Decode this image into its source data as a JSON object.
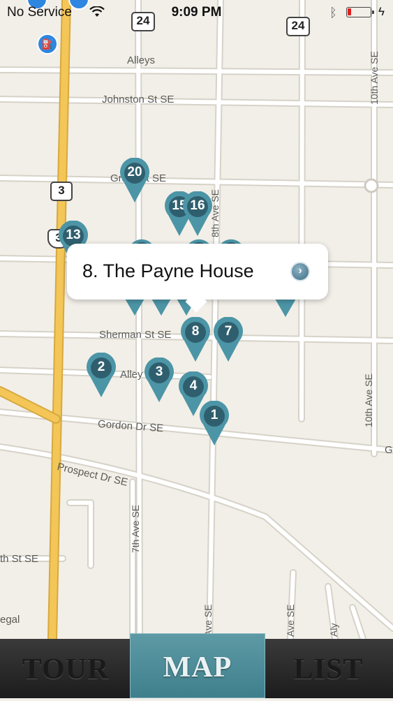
{
  "status_bar": {
    "carrier": "No Service",
    "time": "9:09 PM"
  },
  "map": {
    "street_labels": {
      "alleys_top": "Alleys",
      "johnston": "Johnston St SE",
      "grant": "Grant St SE",
      "sherman": "Sherman St SE",
      "alley_mid": "Alley",
      "gordon": "Gordon Dr SE",
      "prospect": "Prospect Dr SE",
      "street_left": "th St SE",
      "tenth_ave_top": "10th Ave SE",
      "tenth_ave_bottom": "10th Ave SE",
      "seventh_ave": "7th Ave SE",
      "eighth_ave_top": "8th Ave SE",
      "ave_se_bottom": "Ave SE",
      "ave_se_bottom2": "Ave SE",
      "aly": "Aly",
      "legal": "egal",
      "right_edge_g": "G"
    },
    "highway_shields": {
      "shield_24_left": "24",
      "shield_24_right": "24",
      "shield_3_state": "3",
      "shield_3_us": "3"
    },
    "pins": [
      {
        "num": "20"
      },
      {
        "num": "15"
      },
      {
        "num": "16"
      },
      {
        "num": "13"
      },
      {
        "num": "8"
      },
      {
        "num": "7"
      },
      {
        "num": "2"
      },
      {
        "num": "3"
      },
      {
        "num": "4"
      },
      {
        "num": "1"
      }
    ],
    "callout": {
      "title": "8. The Payne House"
    }
  },
  "tab_bar": {
    "tabs": [
      {
        "label": "TOUR",
        "selected": false
      },
      {
        "label": "MAP",
        "selected": true
      },
      {
        "label": "LIST",
        "selected": false
      }
    ]
  },
  "colors": {
    "pin_teal": "#4c95a6",
    "pin_head": "#2f5f6e",
    "map_bg": "#f2efe8",
    "highway": "#f3c657"
  }
}
